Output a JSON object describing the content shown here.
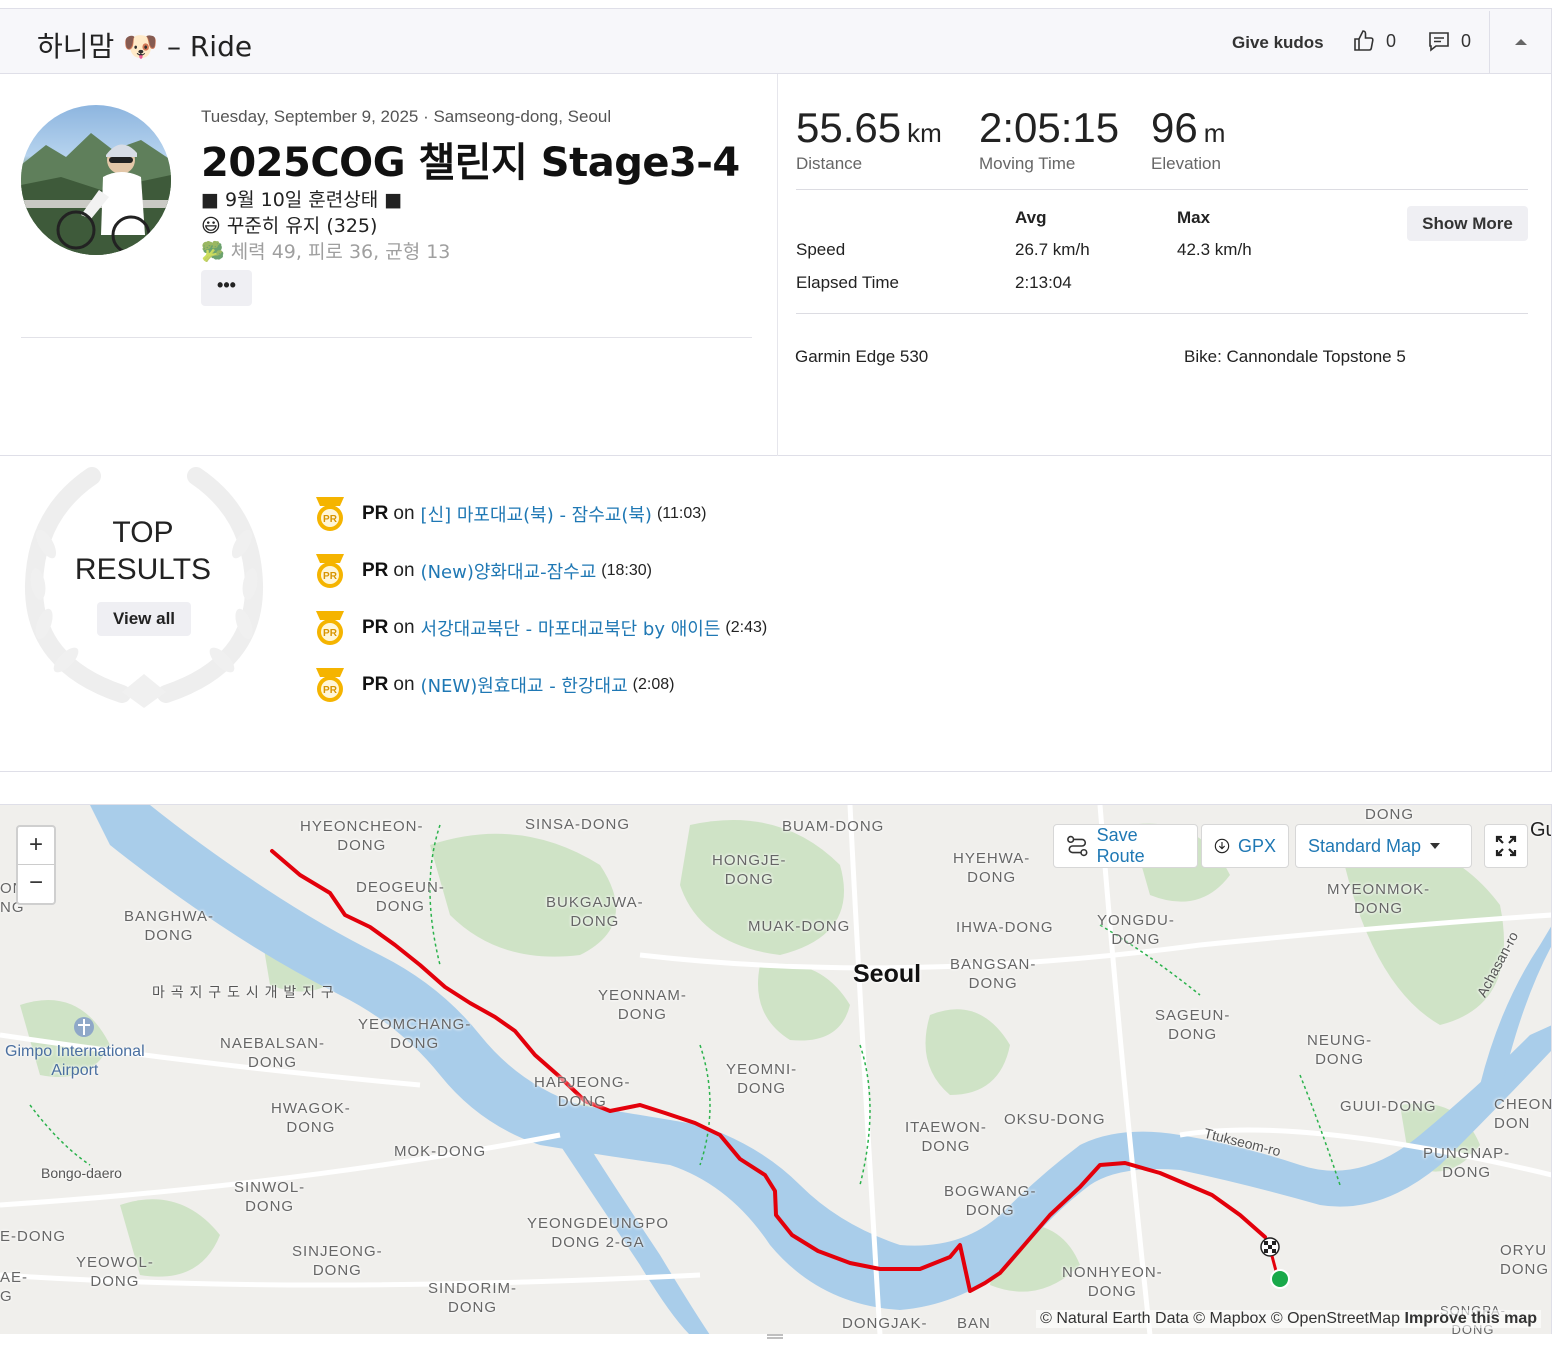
{
  "header": {
    "title": "하니맘 🐶 – Ride",
    "kudos_label": "Give kudos",
    "kudos_count": "0",
    "comment_count": "0"
  },
  "activity": {
    "date_location": "Tuesday, September 9, 2025 · Samseong-dong, Seoul",
    "title": "2025COG 챌린지 Stage3-4",
    "description_lines": [
      "■ 9월 10일 훈련상태 ■",
      "😃 꾸준히 유지 (325)",
      "🥦 체력 49, 피로 36, 균형 13"
    ],
    "more_label": "•••"
  },
  "stats": {
    "distance": {
      "value": "55.65",
      "unit": "km",
      "label": "Distance"
    },
    "moving_time": {
      "value": "2:05:15",
      "label": "Moving Time"
    },
    "elevation": {
      "value": "96",
      "unit": "m",
      "label": "Elevation"
    },
    "table": {
      "avg_header": "Avg",
      "max_header": "Max",
      "rows": [
        {
          "label": "Speed",
          "avg": "26.7 km/h",
          "max": "42.3 km/h"
        },
        {
          "label": "Elapsed Time",
          "avg": "2:13:04",
          "max": ""
        }
      ]
    },
    "show_more_label": "Show More",
    "device": "Garmin Edge 530",
    "bike": "Bike: Cannondale Topstone 5"
  },
  "top_results": {
    "title_line1": "TOP",
    "title_line2": "RESULTS",
    "view_all_label": "View all",
    "items": [
      {
        "badge": "PR",
        "on": "on",
        "segment": "[신] 마포대교(북) - 잠수교(북)",
        "time": "(11:03)"
      },
      {
        "badge": "PR",
        "on": "on",
        "segment": "(New)양화대교-잠수교",
        "time": "(18:30)"
      },
      {
        "badge": "PR",
        "on": "on",
        "segment": "서강대교북단 - 마포대교북단 by 애이든",
        "time": "(2:43)"
      },
      {
        "badge": "PR",
        "on": "on",
        "segment": "(NEW)원효대교 - 한강대교",
        "time": "(2:08)"
      }
    ]
  },
  "map": {
    "zoom_in": "+",
    "zoom_out": "−",
    "save_route_label": "Save Route",
    "gpx_label": "GPX",
    "map_style_label": "Standard Map",
    "attribution": "© Natural Earth Data © Mapbox © OpenStreetMap",
    "improve_label": "Improve this map",
    "route_color": "#e3000b",
    "labels": {
      "hyeoncheon": "HYEONCHEON-\nDONG",
      "sinsa": "SINSA-DONG",
      "buam": "BUAM-DONG",
      "hongje": "HONGJE-\nDONG",
      "hyehwa": "HYEHWA-\nDONG",
      "myeonmok": "MYEONMOK-\nDONG",
      "deogeun": "DEOGEUN-\nDONG",
      "bukgajwa": "BUKGAJWA-\nDONG",
      "muak": "MUAK-DONG",
      "ihwa": "IHWA-DONG",
      "yongdu": "YONGDU-\nDONG",
      "banghwa": "BANGHWA-\nDONG",
      "seoul": "Seoul",
      "bangsan": "BANGSAN-\nDONG",
      "magok": "마 곡 지 구 도 시 개 발 지 구",
      "yeonnam": "YEONNAM-\nDONG",
      "achasan": "Achasan-ro",
      "gimpo": "Gimpo International\nAirport",
      "yeomchang": "YEOMCHANG-\nDONG",
      "naebalsan": "NAEBALSAN-\nDONG",
      "sageun": "SAGEUN-\nDONG",
      "neung": "NEUNG-\nDONG",
      "yeomni": "YEOMNI-\nDONG",
      "hapjeong": "HAPJEONG-\nDONG",
      "hwagok": "HWAGOK-\nDONG",
      "guui": "GUUI-DONG",
      "cheon": "CHEON\nDON",
      "itaewon": "ITAEWON-\nDONG",
      "oksu": "OKSU-DONG",
      "ttukseom": "Ttukseom-ro",
      "mok": "MOK-DONG",
      "bongo": "Bongo-daero",
      "pungnap": "PUNGNAP-\nDONG",
      "sinwol": "SINWOL-\nDONG",
      "bogwang": "BOGWANG-\nDONG",
      "edong": "E-DONG",
      "yeongdeungpo": "YEONGDEUNGPO\nDONG 2-GA",
      "oryu": "ORYU\nDONG",
      "yeowol": "YEOWOL-\nDONG",
      "sinjeong": "SINJEONG-\nDONG",
      "nonhyeon": "NONHYEON-\nDONG",
      "sindorim": "SINDORIM-\nDONG",
      "dongjak": "DONGJAK-",
      "ban": "BAN",
      "ae": "AE-\nG",
      "on": "ON\nNG",
      "dong_top": "DONG",
      "gu": "Gu",
      "songpa": "SONGPA-\nDONG"
    }
  }
}
